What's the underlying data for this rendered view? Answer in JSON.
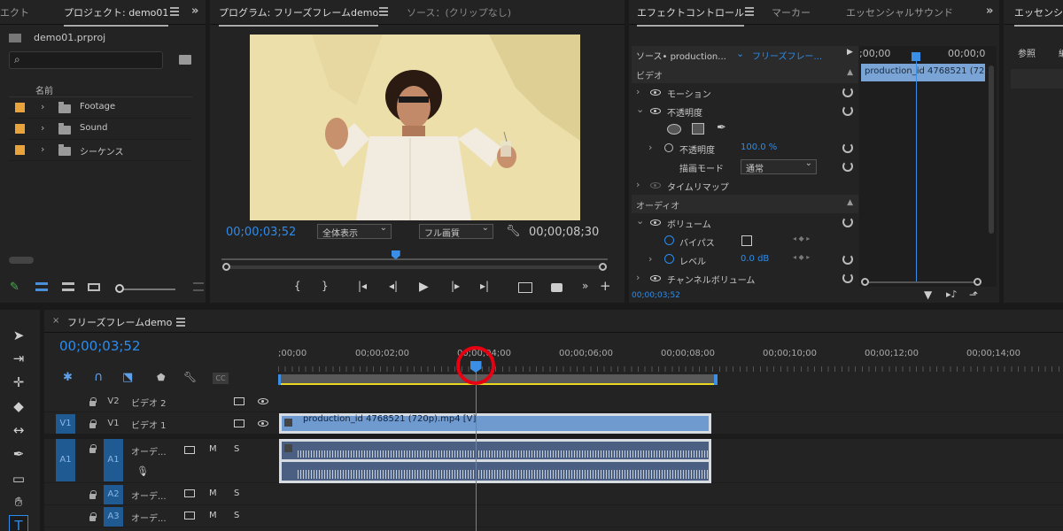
{
  "project_panel": {
    "cut_tab": "エクト",
    "tab": "プロジェクト: demo01",
    "file": "demo01.prproj",
    "column_name": "名前",
    "items": [
      {
        "label": "Footage",
        "color": "#e8a33b"
      },
      {
        "label": "Sound",
        "color": "#e8a33b"
      },
      {
        "label": "シーケンス",
        "color": "#e8a33b"
      }
    ]
  },
  "program_monitor": {
    "tab": "プログラム: フリーズフレームdemo",
    "source_tab": "ソース：(クリップなし)",
    "timecode_current": "00;00;03;52",
    "zoom": "全体表示",
    "quality": "フル画質",
    "timecode_duration": "00;00;08;30",
    "playhead_fraction": 0.45
  },
  "effect_controls": {
    "tab": "エフェクトコントロール",
    "marker_tab": "マーカー",
    "essential_tab": "エッセンシャルサウンド",
    "source_label": "ソース• production...",
    "sequence_label": "フリーズフレー...",
    "timecode_left": ";00;00",
    "timecode_right": "00;00;0",
    "clip_name": "production_id 4768521 (720",
    "video_section": "ビデオ",
    "motion": "モーション",
    "opacity": "不透明度",
    "opacity_param": "不透明度",
    "opacity_value": "100.0 %",
    "blend_mode_label": "描画モード",
    "blend_mode_value": "通常",
    "time_remap": "タイムリマップ",
    "audio_section": "オーディオ",
    "volume": "ボリューム",
    "bypass": "バイパス",
    "level": "レベル",
    "level_value": "0.0 dB",
    "channel_volume": "チャンネルボリューム",
    "bottom_timecode": "00;00;03;52"
  },
  "right_panel": {
    "tab": "エッセンシャ",
    "browse": "参照",
    "edit": "編"
  },
  "timeline": {
    "tab": "フリーズフレームdemo",
    "timecode": "00;00;03;52",
    "ruler_labels": [
      ";00;00",
      "00;00;02;00",
      "00;00;04;00",
      "00;00;06;00",
      "00;00;08;00",
      "00;00;10;00",
      "00;00;12;00",
      "00;00;14;00"
    ],
    "tracks": [
      {
        "target": "",
        "name": "V2",
        "label": "ビデオ 2"
      },
      {
        "target": "V1",
        "name": "V1",
        "label": "ビデオ 1"
      },
      {
        "target": "A1",
        "name": "A1",
        "label": "オーデ..."
      },
      {
        "target": "",
        "name": "A2",
        "label": "オーデ..."
      },
      {
        "target": "",
        "name": "A3",
        "label": "オーデ..."
      }
    ],
    "video_clip": "production_id 4768521 (720p).mp4 [V]",
    "m": "M",
    "s": "S",
    "cc": "CC",
    "playhead_seconds": 3.87
  }
}
